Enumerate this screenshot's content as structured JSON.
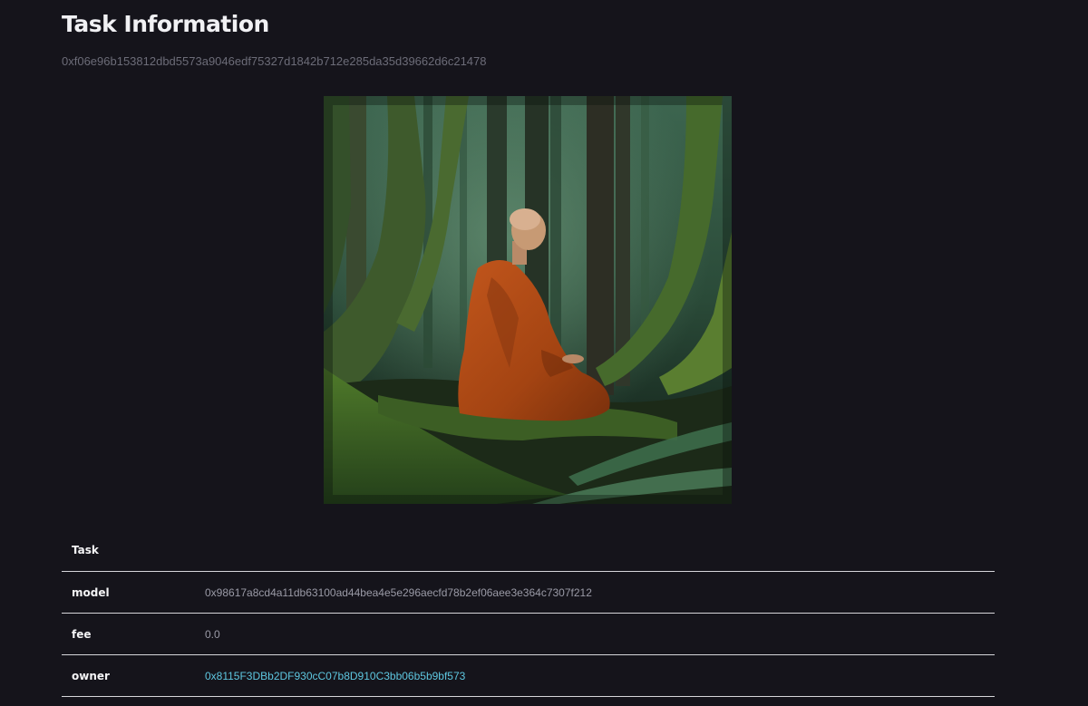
{
  "page": {
    "title": "Task Information",
    "task_hash": "0xf06e96b153812dbd5573a9046edf75327d1842b712e285da35d39662d6c21478"
  },
  "image": {
    "subject": "monk-meditating-in-forest"
  },
  "details": {
    "header": "Task",
    "rows": [
      {
        "label": "model",
        "value": "0x98617a8cd4a11db63100ad44bea4e5e296aecfd78b2ef06aee3e364c7307f212"
      },
      {
        "label": "fee",
        "value": "0.0"
      },
      {
        "label": "owner",
        "value": "0x8115F3DBb2DF930cC07b8D910C3bb06b5b9bf573"
      }
    ]
  },
  "colors": {
    "background": "#15141b",
    "title": "#f1f1f4",
    "muted": "#6c6c78",
    "link": "#5ec7e0",
    "divider": "#d6d6da"
  }
}
